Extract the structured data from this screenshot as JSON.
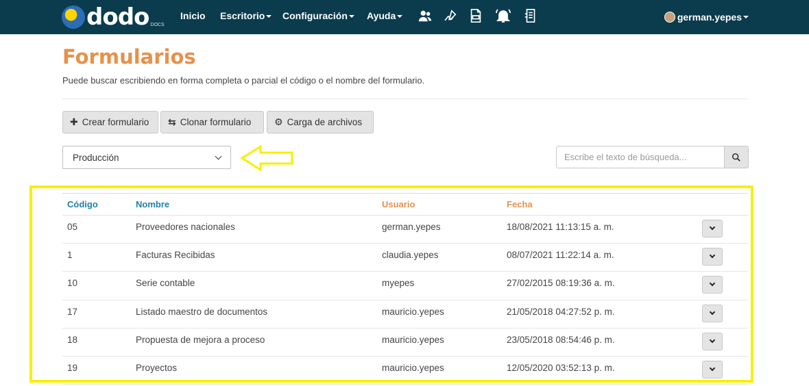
{
  "navbar": {
    "logo_text": "dodo",
    "logo_sub": "DOCS",
    "items": [
      {
        "label": "Inicio"
      },
      {
        "label": "Escritorio"
      },
      {
        "label": "Configuración"
      },
      {
        "label": "Ayuda"
      }
    ],
    "icons": [
      "users-icon",
      "signature-icon",
      "xlsx-file-icon",
      "bell-icon",
      "document-list-icon"
    ],
    "user": "german.yepes"
  },
  "page": {
    "title": "Formularios",
    "description": "Puede buscar escribiendo en forma completa o parcial el código o el nombre del formulario."
  },
  "toolbar": {
    "create_label": "Crear formulario",
    "clone_label": "Clonar formulario",
    "upload_label": "Carga de archivos"
  },
  "filter": {
    "selected": "Producción"
  },
  "search": {
    "placeholder": "Escribe el texto de búsqueda..."
  },
  "table": {
    "headers": {
      "code": "Código",
      "name": "Nombre",
      "user": "Usuario",
      "date": "Fecha"
    },
    "rows": [
      {
        "code": "05",
        "name": "Proveedores nacionales",
        "user": "german.yepes",
        "date": "18/08/2021 11:13:15 a. m."
      },
      {
        "code": "1",
        "name": "Facturas Recibidas",
        "user": "claudia.yepes",
        "date": "08/07/2021 11:22:14 a. m."
      },
      {
        "code": "10",
        "name": "Serie contable",
        "user": "myepes",
        "date": "27/02/2015 08:19:36 a. m."
      },
      {
        "code": "17",
        "name": "Listado maestro de documentos",
        "user": "mauricio.yepes",
        "date": "21/05/2018 04:27:52 p. m."
      },
      {
        "code": "18",
        "name": "Propuesta de mejora a proceso",
        "user": "mauricio.yepes",
        "date": "23/05/2018 08:54:46 p. m."
      },
      {
        "code": "19",
        "name": "Proyectos",
        "user": "mauricio.yepes",
        "date": "12/05/2020 03:52:13 p. m."
      }
    ]
  },
  "colors": {
    "navbar": "#0b3c4d",
    "title": "#e8914a",
    "header_blue": "#1f7fa8",
    "annotation_yellow": "#f7f000"
  }
}
